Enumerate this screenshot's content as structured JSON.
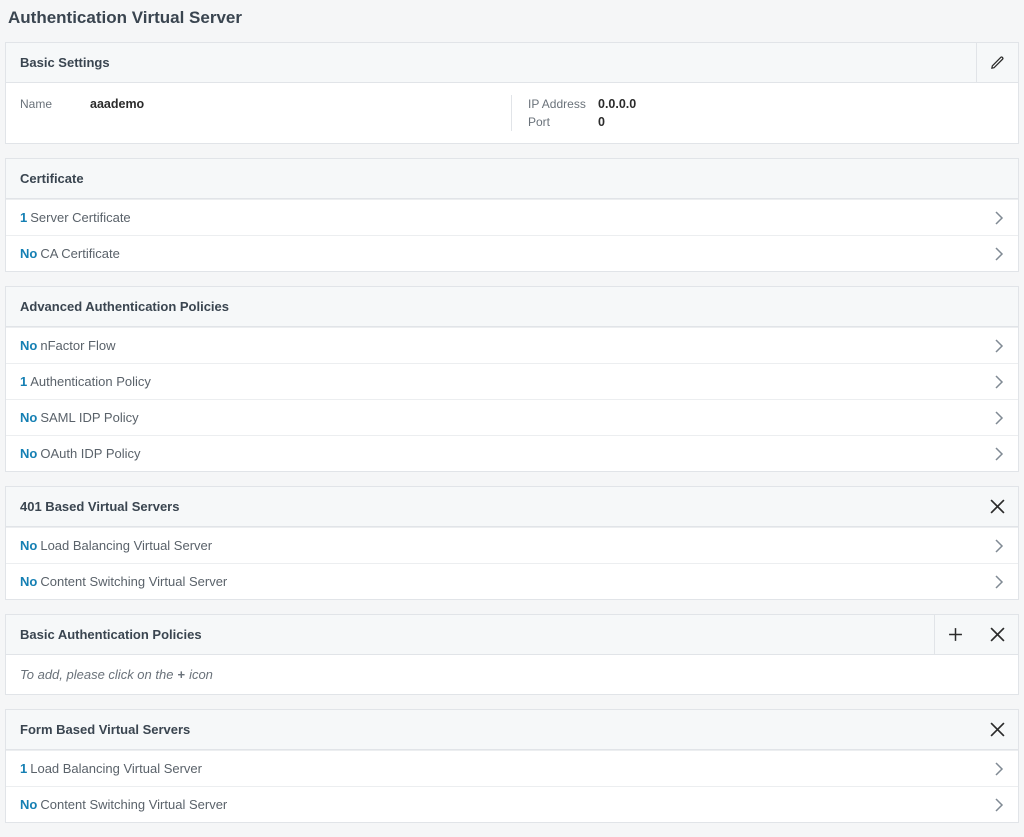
{
  "page_title": "Authentication Virtual Server",
  "basic_settings": {
    "header": "Basic Settings",
    "name_label": "Name",
    "name_value": "aaademo",
    "ip_label": "IP Address",
    "ip_value": "0.0.0.0",
    "port_label": "Port",
    "port_value": "0"
  },
  "certificate": {
    "header": "Certificate",
    "items": [
      {
        "count": "1",
        "label": "Server Certificate"
      },
      {
        "count": "No",
        "label": "CA Certificate"
      }
    ]
  },
  "advanced_auth": {
    "header": "Advanced Authentication Policies",
    "items": [
      {
        "count": "No",
        "label": "nFactor Flow"
      },
      {
        "count": "1",
        "label": "Authentication Policy"
      },
      {
        "count": "No",
        "label": "SAML IDP Policy"
      },
      {
        "count": "No",
        "label": "OAuth IDP Policy"
      }
    ]
  },
  "vs401": {
    "header": "401 Based Virtual Servers",
    "items": [
      {
        "count": "No",
        "label": "Load Balancing Virtual Server"
      },
      {
        "count": "No",
        "label": "Content Switching Virtual Server"
      }
    ]
  },
  "basic_auth": {
    "header": "Basic Authentication Policies",
    "placeholder_pre": "To add, please click on the",
    "placeholder_icon": "+",
    "placeholder_post": "icon"
  },
  "form_vs": {
    "header": "Form Based Virtual Servers",
    "items": [
      {
        "count": "1",
        "label": "Load Balancing Virtual Server"
      },
      {
        "count": "No",
        "label": "Content Switching Virtual Server"
      }
    ]
  }
}
